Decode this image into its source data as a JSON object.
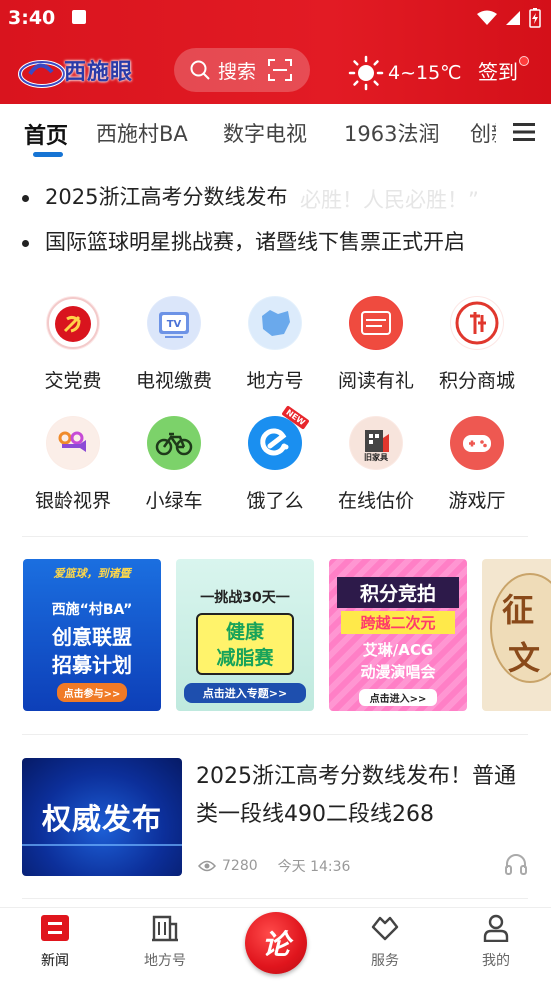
{
  "status_bar": {
    "time": "3:40"
  },
  "header": {
    "logo_text": "西施眼",
    "search_label": "搜索",
    "weather_temp": "4~15℃",
    "signin_label": "签到"
  },
  "tabs": [
    {
      "label": "首页",
      "active": true
    },
    {
      "label": "西施村BA"
    },
    {
      "label": "数字电视"
    },
    {
      "label": "1963法润"
    },
    {
      "label": "创新"
    }
  ],
  "headlines": [
    "2025浙江高考分数线发布",
    "国际篮球明星挑战赛，诸暨线下售票正式开启"
  ],
  "headline_ghost": "必胜！人民必胜！”",
  "services": [
    {
      "label": "交党费",
      "icon": "party-icon"
    },
    {
      "label": "电视缴费",
      "icon": "tv-icon"
    },
    {
      "label": "地方号",
      "icon": "map-icon"
    },
    {
      "label": "阅读有礼",
      "icon": "reading-icon"
    },
    {
      "label": "积分商城",
      "icon": "points-icon"
    },
    {
      "label": "银龄视界",
      "icon": "video-icon"
    },
    {
      "label": "小绿车",
      "icon": "bike-icon"
    },
    {
      "label": "饿了么",
      "icon": "eleme-icon"
    },
    {
      "label": "在线估价",
      "icon": "house-icon"
    },
    {
      "label": "游戏厅",
      "icon": "gamepad-icon"
    }
  ],
  "eleme_badge": "NEW",
  "banners": [
    {
      "name": "village-ba",
      "lines": [
        "爱篮球，到诸暨",
        "西施“村BA”",
        "创意联盟",
        "招募计划",
        "点击参与>>"
      ]
    },
    {
      "name": "fitness",
      "lines": [
        "一挑战30天一",
        "健康",
        "减脂赛",
        "点击进入专题>>"
      ]
    },
    {
      "name": "points-auction",
      "lines": [
        "积分竞拍",
        "跨越二次元",
        "艾琳/ACG",
        "动漫演唱会",
        "点击进入>>"
      ]
    },
    {
      "name": "essay",
      "lines": [
        "征",
        "文"
      ]
    }
  ],
  "news": {
    "thumb_text": "权威发布",
    "title": "2025浙江高考分数线发布！普通类一段线490二段线268",
    "views": "7280",
    "time": "今天 14:36"
  },
  "bottom_nav": [
    {
      "label": "新闻",
      "active": true
    },
    {
      "label": "地方号"
    },
    {
      "label": "论"
    },
    {
      "label": "服务"
    },
    {
      "label": "我的"
    }
  ],
  "colors": {
    "brand_red": "#e21b24",
    "tab_accent": "#1674d4"
  }
}
